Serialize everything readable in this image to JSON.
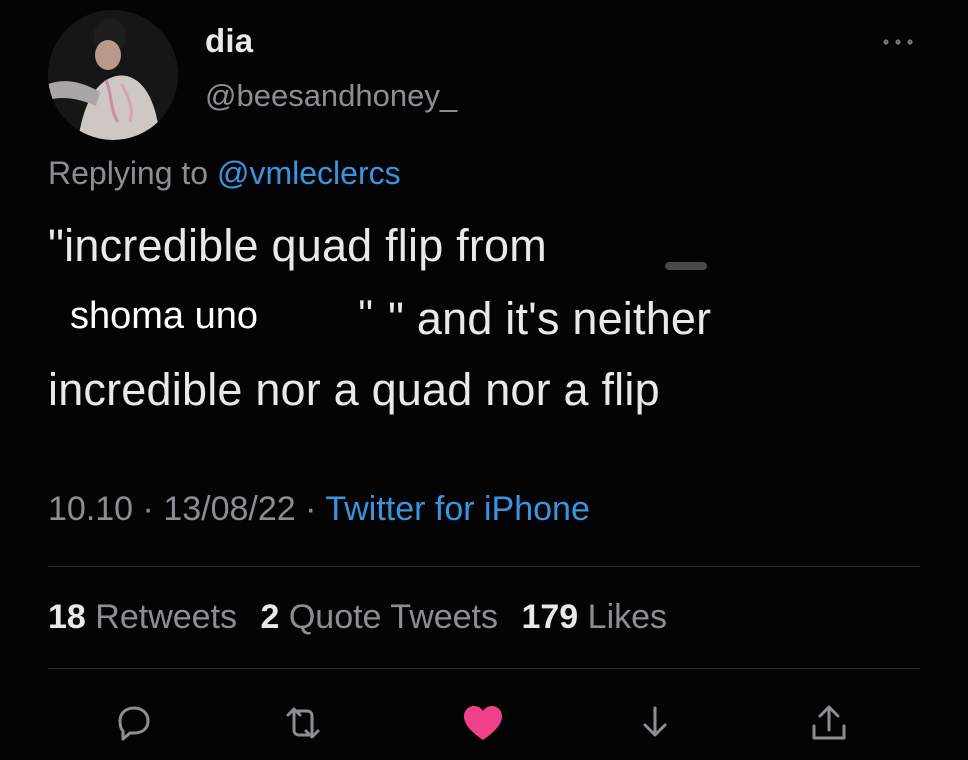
{
  "user": {
    "display_name": "dia",
    "handle": "@beesandhoney_"
  },
  "reply": {
    "prefix": "Replying to",
    "mention": "@vmleclercs"
  },
  "body": {
    "line1": "\"incredible quad flip from",
    "line2": "\" and it's neither",
    "line3": "incredible nor a quad nor a flip",
    "quote_mark": "''",
    "overlay_name": "shoma uno"
  },
  "meta": {
    "time": "10.10",
    "separator": "·",
    "date": "13/08/22",
    "source": "Twitter for iPhone"
  },
  "stats": {
    "retweets_count": "18",
    "retweets_label": "Retweets",
    "quotes_count": "2",
    "quotes_label": "Quote Tweets",
    "likes_count": "179",
    "likes_label": "Likes"
  },
  "actions": [
    "reply-icon",
    "retweet-icon",
    "like-icon",
    "bookmark-icon",
    "share-icon"
  ],
  "colors": {
    "background": "#040404",
    "text": "#e7e9ea",
    "muted": "#8b8f93",
    "link": "#3a94e0",
    "like": "#f0408a"
  }
}
